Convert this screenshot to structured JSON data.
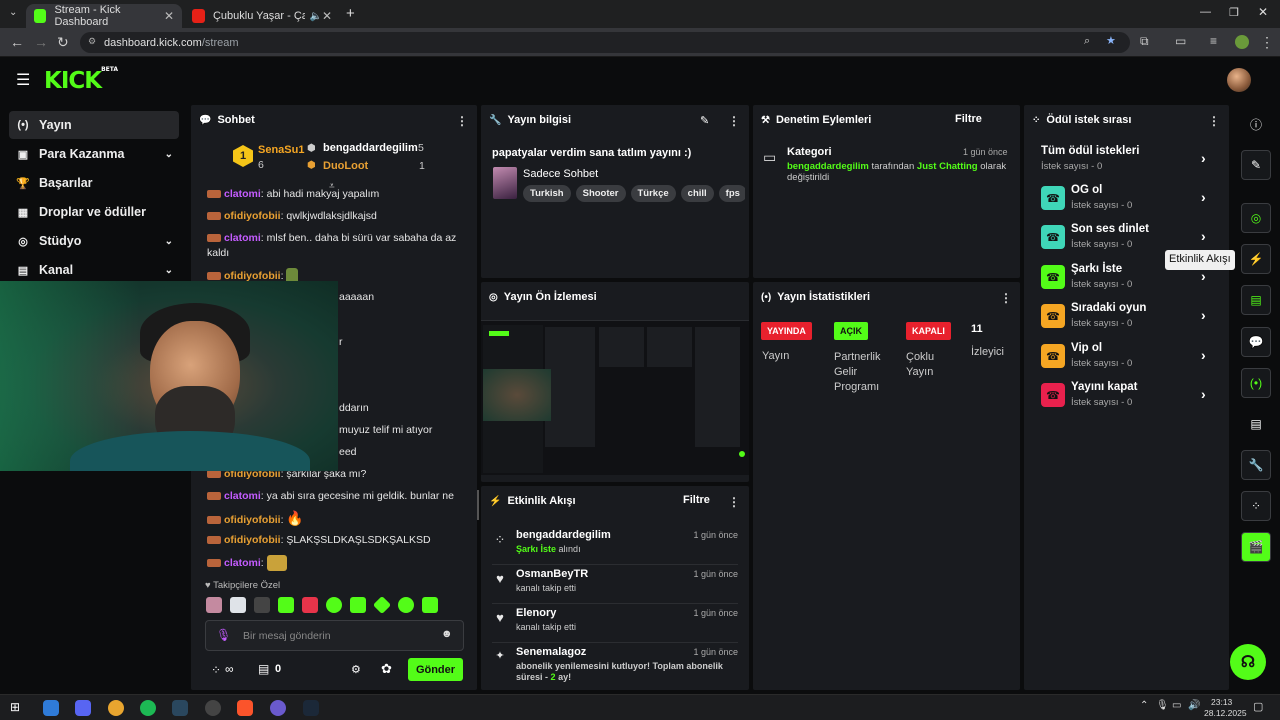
{
  "browser": {
    "tabs": [
      {
        "title": "Stream - Kick Dashboard",
        "active": true
      },
      {
        "title": "Çubuklu Yaşar - Çam Diktin",
        "active": false
      }
    ],
    "url_host": "dashboard.kick.com",
    "url_path": "/stream"
  },
  "header": {
    "logo": "KICK",
    "logo_sup": "BETA"
  },
  "sidebar": {
    "items": [
      {
        "label": "Yayın",
        "icon": "broadcast-icon",
        "active": true,
        "expandable": false
      },
      {
        "label": "Para Kazanma",
        "icon": "money-icon",
        "expandable": true
      },
      {
        "label": "Başarılar",
        "icon": "trophy-icon",
        "expandable": false
      },
      {
        "label": "Droplar ve ödüller",
        "icon": "gift-icon",
        "expandable": false
      },
      {
        "label": "Stüdyo",
        "icon": "studio-icon",
        "expandable": true
      },
      {
        "label": "Kanal",
        "icon": "channel-icon",
        "expandable": true
      }
    ]
  },
  "chat": {
    "title": "Sohbet",
    "leaderboard": {
      "rank": "1",
      "first": {
        "name": "SenaSu1",
        "count": "6"
      },
      "second": {
        "name": "bengaddardegilim",
        "count": "5"
      },
      "third": {
        "name": "DuoLoot",
        "count": "1"
      }
    },
    "messages": [
      {
        "user": "clatomi",
        "text": "abi hadi makyaj yapalım"
      },
      {
        "user": "ofidiyofobii",
        "text": "qwlkjwdlaksjdlkajsd"
      },
      {
        "user": "clatomi",
        "text": "mlsf ben.. daha bi sürü var sabaha da az kaldı"
      },
      {
        "user": "ofidiyofobii",
        "text": ""
      },
      {
        "user": "",
        "text": "aaaaan"
      },
      {
        "user": "",
        "text": "r"
      },
      {
        "user": "",
        "text": "ddarın"
      },
      {
        "user": "",
        "text": "muyuz telif mi atıyor"
      },
      {
        "user": "",
        "text": "eed"
      },
      {
        "user": "ofidiyofobii",
        "text": "şarkılar şaka mı?"
      },
      {
        "user": "clatomi",
        "text": "ya abi sıra gecesine mi geldik. bunlar ne"
      },
      {
        "user": "ofidiyofobii",
        "text": ""
      },
      {
        "user": "ofidiyofobii",
        "text": "ŞLAKŞSLDKAŞLSDKŞALKSD"
      },
      {
        "user": "clatomi",
        "text": ""
      }
    ],
    "followers_only_label": "Takipçilere Özel",
    "input_placeholder": "Bir mesaj gönderin",
    "points": "∞",
    "chest_count": "0",
    "send_label": "Gönder"
  },
  "stream_info": {
    "title": "Yayın bilgisi",
    "stream_title": "papatyalar verdim sana tatlım yayını :)",
    "category": "Sadece Sohbet",
    "tags": [
      "Turkish",
      "Shooter",
      "Türkçe",
      "chill",
      "fps"
    ]
  },
  "moderation": {
    "title": "Denetim Eylemleri",
    "filter": "Filtre",
    "entry": {
      "label": "Kategori",
      "time": "1 gün önce",
      "actor": "bengaddardegilim",
      "middle": "tarafından",
      "value": "Just Chatting",
      "suffix": "olarak değiştirildi"
    }
  },
  "preview": {
    "title": "Yayın Ön İzlemesi"
  },
  "stats": {
    "title": "Yayın İstatistikleri",
    "items": [
      {
        "badge": "YAYINDA",
        "label": "Yayın",
        "color": "#e8212d"
      },
      {
        "badge": "AÇIK",
        "label": "Partnerlik Gelir Programı",
        "color": "#53fc18"
      },
      {
        "badge": "KAPALI",
        "label": "Çoklu Yayın",
        "color": "#e8212d"
      }
    ],
    "viewers": "11",
    "viewers_label": "İzleyici"
  },
  "activity": {
    "title": "Etkinlik Akışı",
    "filter": "Filtre",
    "events": [
      {
        "name": "bengaddardegilim",
        "time": "1 gün önce",
        "highlight": "Şarkı İste",
        "desc": "alındı",
        "icon": "reward-icon"
      },
      {
        "name": "OsmanBeyTR",
        "time": "1 gün önce",
        "highlight": "",
        "desc": "kanalı takip etti",
        "icon": "heart-icon"
      },
      {
        "name": "Elenory",
        "time": "1 gün önce",
        "highlight": "",
        "desc": "kanalı takip etti",
        "icon": "heart-icon"
      },
      {
        "name": "Senemalagoz",
        "time": "1 gün önce",
        "highlight": "2",
        "desc": "abonelik yenilemesini kutluyor! Toplam abonelik süresi -",
        "desc_suffix": "ay!",
        "icon": "star-icon"
      }
    ]
  },
  "rewards": {
    "title": "Ödül istek sırası",
    "items": [
      {
        "label": "Tüm ödül istekleri",
        "sub": "İstek sayısı - 0",
        "color": ""
      },
      {
        "label": "OG ol",
        "sub": "İstek sayısı - 0",
        "color": "#3fd6b8"
      },
      {
        "label": "Son ses dinlet",
        "sub": "İstek sayısı - 0",
        "color": "#3fd6b8"
      },
      {
        "label": "Şarkı İste",
        "sub": "İstek sayısı - 0",
        "color": "#53fc18"
      },
      {
        "label": "Sıradaki oyun",
        "sub": "İstek sayısı - 0",
        "color": "#f5a623"
      },
      {
        "label": "Vip ol",
        "sub": "İstek sayısı - 0",
        "color": "#f5a623"
      },
      {
        "label": "Yayını kapat",
        "sub": "İstek sayısı - 0",
        "color": "#e8214d"
      }
    ]
  },
  "rail": {
    "tooltip": "Etkinlik Akışı"
  },
  "taskbar": {
    "time": "23:13",
    "date": "28.12.2025"
  }
}
